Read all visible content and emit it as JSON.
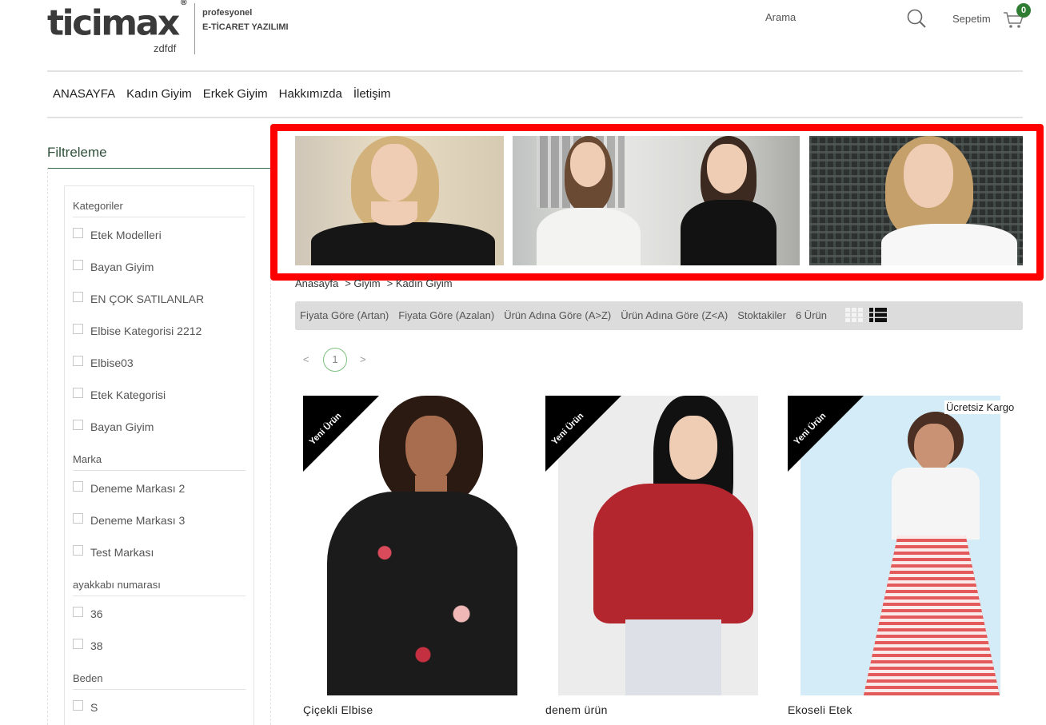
{
  "header": {
    "logo_text": "ticimax",
    "logo_mark": "®",
    "logo_subtitle": "zdfdf",
    "tagline_line1": "profesyonel",
    "tagline_line2": "E-TİCARET YAZILIMI",
    "search_label": "Arama",
    "cart_label": "Sepetim",
    "cart_count": "0"
  },
  "nav": {
    "items": [
      "ANASAYFA",
      "Kadın Giyim",
      "Erkek Giyim",
      "Hakkımızda",
      "İletişim"
    ]
  },
  "filters": {
    "title": "Filtreleme",
    "groups": [
      {
        "title": "Kategoriler",
        "options": [
          "Etek Modelleri",
          "Bayan Giyim",
          "EN ÇOK SATILANLAR",
          "Elbise Kategorisi 2212",
          "Elbise03",
          "Etek Kategorisi",
          "Bayan Giyim"
        ]
      },
      {
        "title": "Marka",
        "options": [
          "Deneme Markası 2",
          "Deneme Markası 3",
          "Test Markası"
        ]
      },
      {
        "title": "ayakkabı numarası",
        "options": [
          "36",
          "38"
        ]
      },
      {
        "title": "Beden",
        "options": [
          "S"
        ]
      }
    ]
  },
  "breadcrumb": [
    "Anasayfa",
    "> Giyim",
    "> Kadın Giyim"
  ],
  "sort": {
    "options": [
      "Fiyata Göre (Artan)",
      "Fiyata Göre (Azalan)",
      "Ürün Adına Göre (A>Z)",
      "Ürün Adına Göre (Z<A)",
      "Stoktakiler"
    ],
    "count": "6 Ürün"
  },
  "pagination": {
    "prev": "<",
    "current": "1",
    "next": ">"
  },
  "products": [
    {
      "name": "Çiçekli Elbise",
      "badge": "Yeni Ürün"
    },
    {
      "name": "denem ürün",
      "badge": "Yeni Ürün"
    },
    {
      "name": "Ekoseli Etek",
      "badge": "Yeni Ürün",
      "tag": "Ücretsiz Kargo"
    }
  ]
}
